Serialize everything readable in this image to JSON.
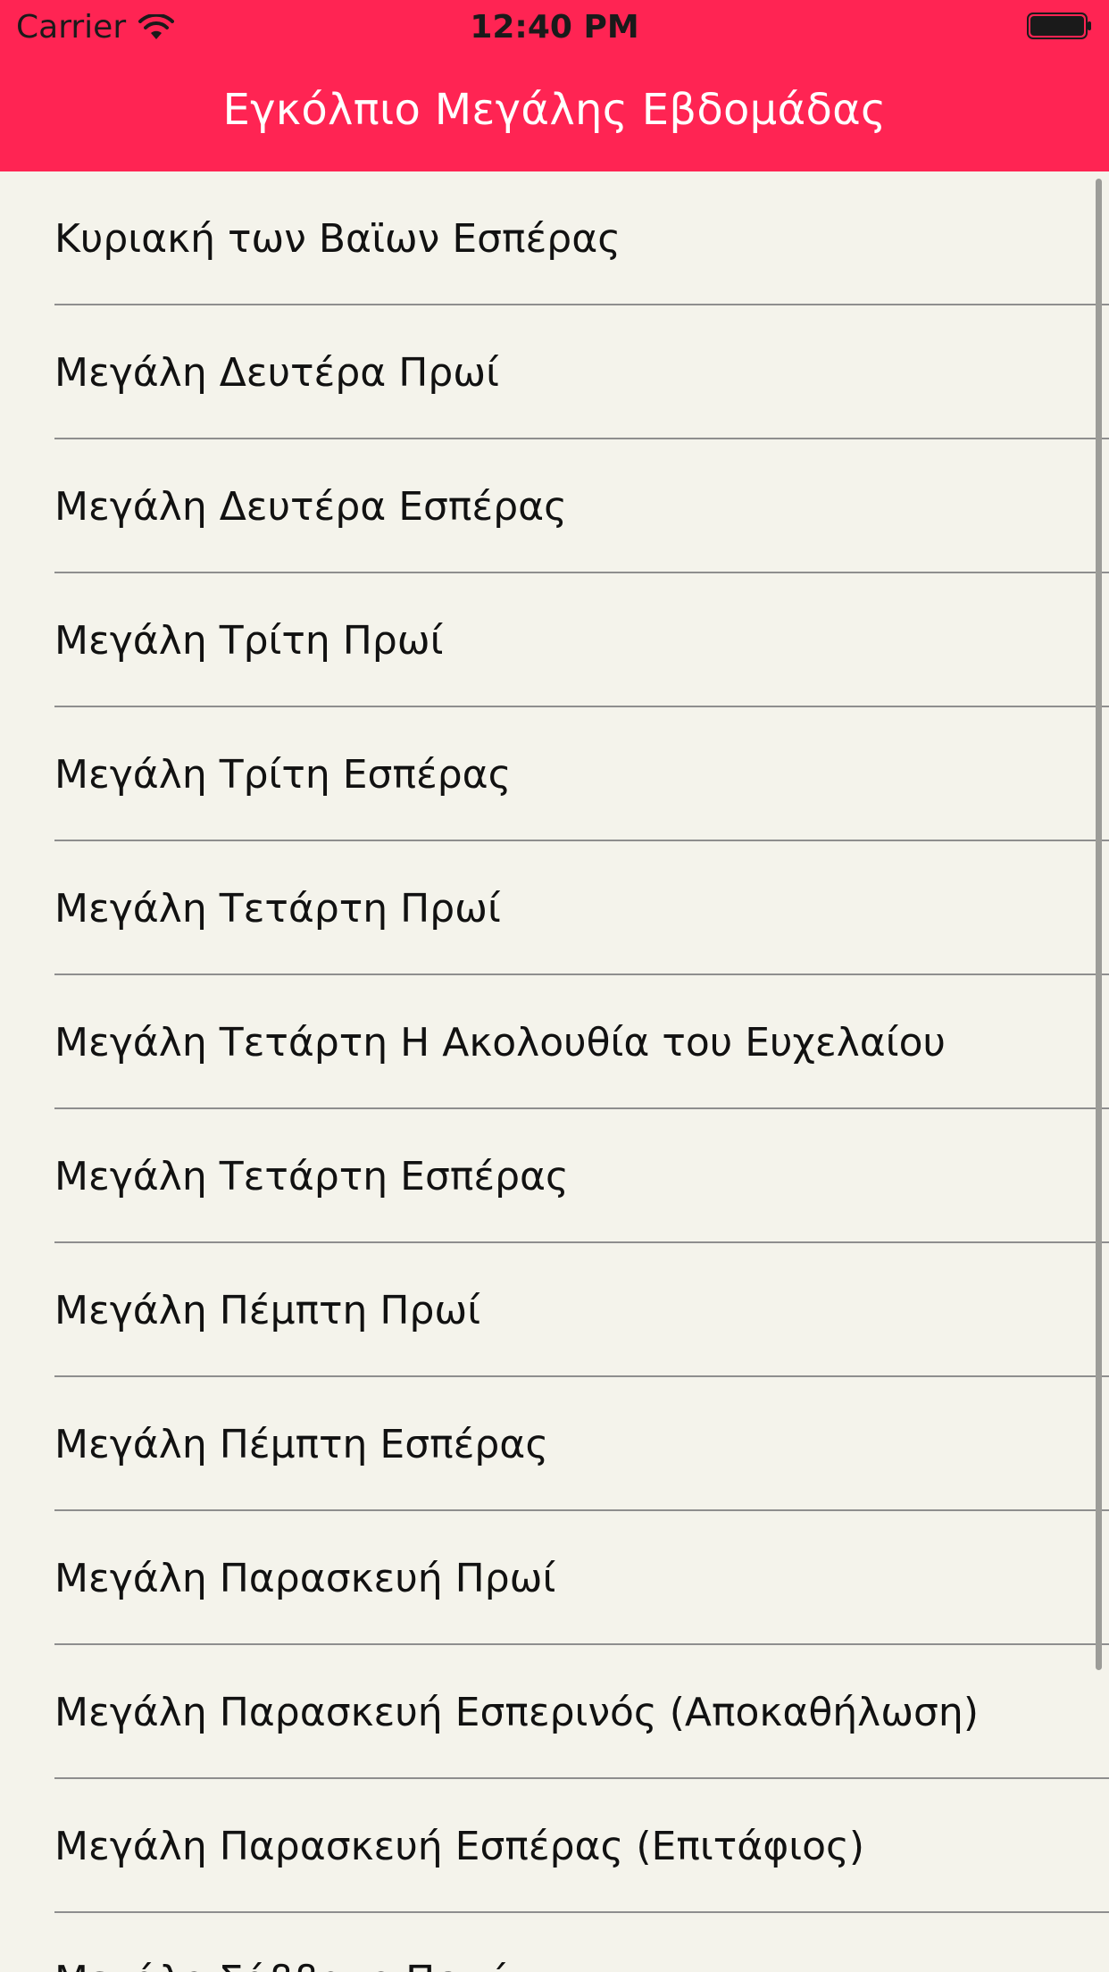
{
  "status": {
    "carrier": "Carrier",
    "time": "12:40 PM"
  },
  "nav": {
    "title": "Εγκόλπιο Μεγάλης Εβδομάδας"
  },
  "colors": {
    "accent": "#FF2453",
    "background": "#F4F3EB"
  },
  "icons": {
    "wifi": "wifi-icon",
    "battery": "battery-icon"
  },
  "items": [
    "Κυριακή των  Βαϊων Εσπέρας",
    "Μεγάλη Δευτέρα Πρωί",
    "Μεγάλη Δευτέρα Εσπέρας",
    "Μεγάλη Τρίτη Πρωί",
    "Μεγάλη Τρίτη Εσπέρας",
    "Μεγάλη Τετάρτη Πρωί",
    "Μεγάλη Τετάρτη Η Ακολουθία του Ευχελαίου",
    "Μεγάλη Τετάρτη Εσπέρας",
    "Μεγάλη Πέμπτη Πρωί",
    "Μεγάλη Πέμπτη Εσπέρας",
    "Μεγάλη Παρασκευή Πρωί",
    "Μεγάλη Παρασκευή Εσπερινός (Αποκαθήλωση)",
    "Μεγάλη Παρασκευή Εσπέρας (Επιτάφιος)",
    "Μεγάλο Σάββατο Πρωί"
  ]
}
